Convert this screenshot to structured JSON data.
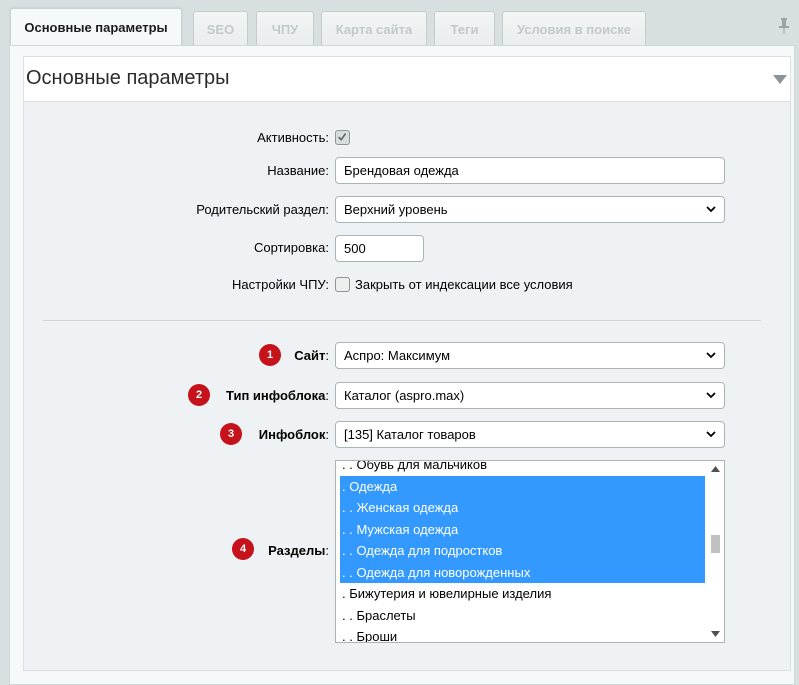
{
  "tabs": [
    {
      "label": "Основные параметры",
      "active": true
    },
    {
      "label": "SEO"
    },
    {
      "label": "ЧПУ"
    },
    {
      "label": "Карта сайта"
    },
    {
      "label": "Теги"
    },
    {
      "label": "Условия в поиске"
    }
  ],
  "section": {
    "title": "Основные параметры"
  },
  "form": {
    "activity": {
      "label": "Активность:",
      "checked": true
    },
    "name": {
      "label": "Название:",
      "value": "Брендовая одежда"
    },
    "parent": {
      "label": "Родительский раздел:",
      "value": "Верхний уровень"
    },
    "sort": {
      "label": "Сортировка:",
      "value": "500"
    },
    "seo_url": {
      "label": "Настройки ЧПУ:",
      "checkbox_label": "Закрыть от индексации все условия",
      "checked": false
    },
    "site": {
      "badge": "1",
      "label": "Сайт",
      "colon": ":",
      "value": "Аспро: Максимум"
    },
    "iblock_type": {
      "badge": "2",
      "label": "Тип инфоблока",
      "colon": ":",
      "value": "Каталог (aspro.max)"
    },
    "iblock": {
      "badge": "3",
      "label": "Инфоблок",
      "colon": ":",
      "value": "[135] Каталог товаров"
    },
    "sections": {
      "badge": "4",
      "label": "Разделы",
      "colon": ":",
      "options": [
        {
          "text": ". . Обувь для мальчиков",
          "selected": false
        },
        {
          "text": ". Одежда",
          "selected": true
        },
        {
          "text": ". . Женская одежда",
          "selected": true
        },
        {
          "text": ". . Мужская одежда",
          "selected": true
        },
        {
          "text": ". . Одежда для подростков",
          "selected": true
        },
        {
          "text": ". . Одежда для новорожденных",
          "selected": true
        },
        {
          "text": ". Бижутерия и ювелирные изделия",
          "selected": false
        },
        {
          "text": ". . Браслеты",
          "selected": false
        },
        {
          "text": ". . Броши",
          "selected": false
        }
      ]
    }
  },
  "colors": {
    "badge": "#c5121b",
    "selection": "#3399ff"
  },
  "icons": {
    "pin": "pin-icon",
    "collapse": "triangle-down-icon",
    "select": "chevron-down-icon",
    "check": "checkmark-icon"
  }
}
